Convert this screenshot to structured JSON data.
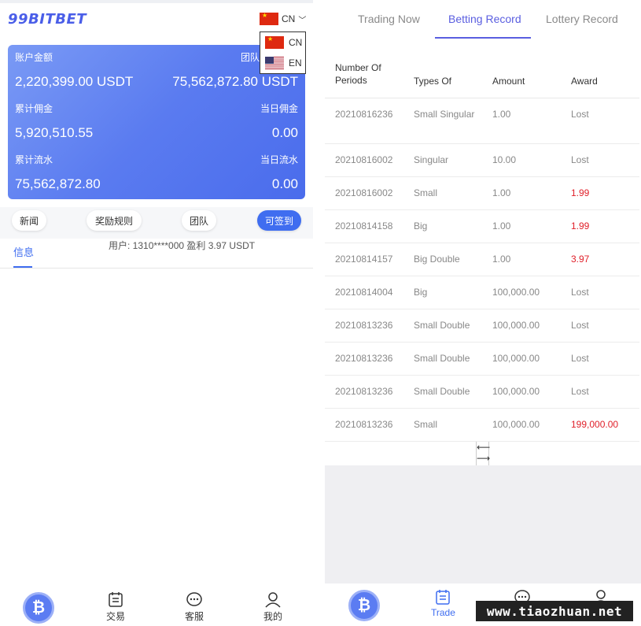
{
  "left": {
    "logo": "99BITBET",
    "language": {
      "current": "CN",
      "options": [
        {
          "code": "CN",
          "flag": "china-flag-icon"
        },
        {
          "code": "EN",
          "flag": "us-flag-icon"
        }
      ]
    },
    "account": {
      "balance_label": "账户金额",
      "balance_value": "2,220,399.00 USDT",
      "team_label": "团队",
      "team_value": "75,562,872.80 USDT",
      "commission_label": "累计佣金",
      "commission_value": "5,920,510.55",
      "today_commission_label": "当日佣金",
      "today_commission_value": "0.00",
      "flow_label": "累计流水",
      "flow_value": "75,562,872.80",
      "today_flow_label": "当日流水",
      "today_flow_value": "0.00"
    },
    "pills": [
      "新闻",
      "奖励规则",
      "团队",
      "可签到"
    ],
    "info_tab": "信息",
    "marquee": "用户: 1310****000 盈利 3.97 USDT",
    "tabbar": [
      "交易",
      "客服",
      "我的"
    ]
  },
  "right": {
    "tabs": [
      "Trading Now",
      "Betting Record",
      "Lottery Record"
    ],
    "active_tab": "Betting Record",
    "columns": [
      "Number Of Periods",
      "Types Of",
      "Amount",
      "Award"
    ],
    "rows": [
      {
        "period": "20210816236",
        "type": "Small Singular",
        "amount": "1.00",
        "award": "Lost",
        "win": false
      },
      {
        "period": "20210816002",
        "type": "Singular",
        "amount": "10.00",
        "award": "Lost",
        "win": false
      },
      {
        "period": "20210816002",
        "type": "Small",
        "amount": "1.00",
        "award": "1.99",
        "win": true
      },
      {
        "period": "20210814158",
        "type": "Big",
        "amount": "1.00",
        "award": "1.99",
        "win": true
      },
      {
        "period": "20210814157",
        "type": "Big Double",
        "amount": "1.00",
        "award": "3.97",
        "win": true
      },
      {
        "period": "20210814004",
        "type": "Big",
        "amount": "100,000.00",
        "award": "Lost",
        "win": false
      },
      {
        "period": "20210813236",
        "type": "Small Double",
        "amount": "100,000.00",
        "award": "Lost",
        "win": false
      },
      {
        "period": "20210813236",
        "type": "Small Double",
        "amount": "100,000.00",
        "award": "Lost",
        "win": false
      },
      {
        "period": "20210813236",
        "type": "Small Double",
        "amount": "100,000.00",
        "award": "Lost",
        "win": false
      },
      {
        "period": "20210813236",
        "type": "Small",
        "amount": "100,000.00",
        "award": "199,000.00",
        "win": true
      }
    ],
    "pager": {
      "prev": "⟵",
      "next": "⟶"
    },
    "tabbar": {
      "trade_label": "Trade"
    }
  },
  "watermark": "www.tiaozhuan.net",
  "colors": {
    "accent": "#3f6df0",
    "tab_active": "#5a5ee0",
    "win": "#e0202a",
    "muted": "#888888"
  }
}
